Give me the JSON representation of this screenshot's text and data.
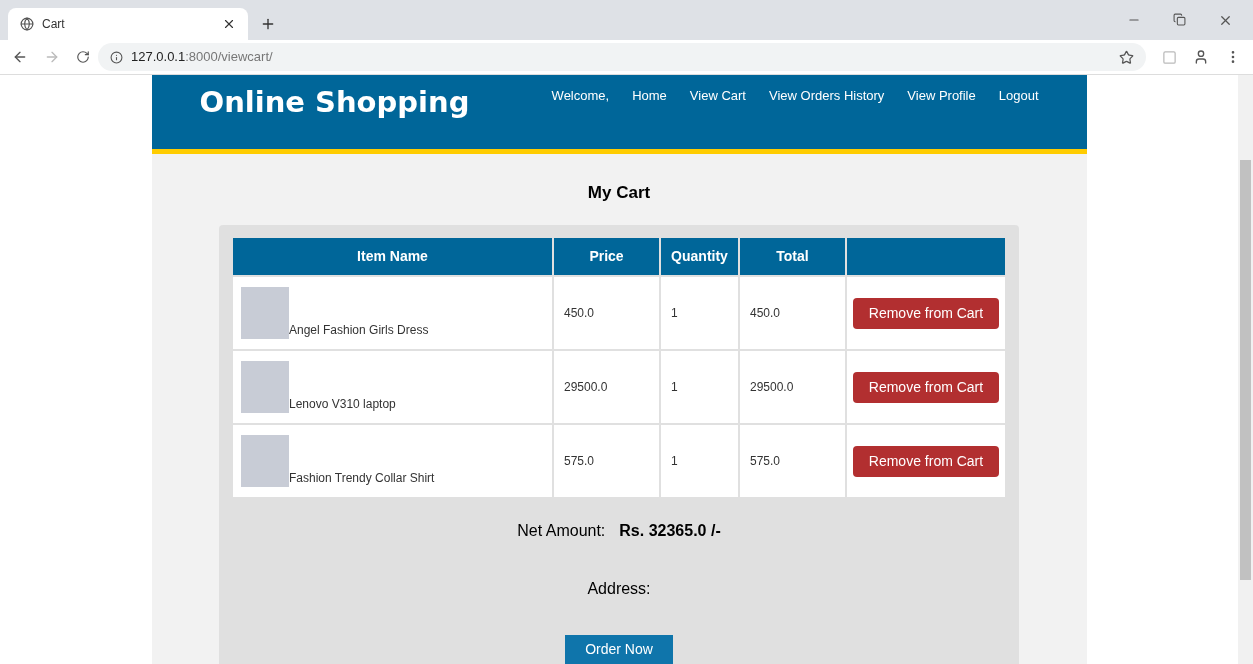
{
  "browser": {
    "tab_title": "Cart",
    "url_host": "127.0.0.1",
    "url_rest": ":8000/viewcart/"
  },
  "header": {
    "brand": "Online Shopping",
    "nav": [
      "Welcome,",
      "Home",
      "View Cart",
      "View Orders History",
      "View Profile",
      "Logout"
    ]
  },
  "page_title": "My Cart",
  "table": {
    "columns": [
      "Item Name",
      "Price",
      "Quantity",
      "Total",
      ""
    ],
    "rows": [
      {
        "name": "Angel Fashion Girls Dress",
        "price": "450.0",
        "quantity": "1",
        "total": "450.0",
        "action": "Remove from Cart"
      },
      {
        "name": "Lenovo V310 laptop",
        "price": "29500.0",
        "quantity": "1",
        "total": "29500.0",
        "action": "Remove from Cart"
      },
      {
        "name": "Fashion Trendy Collar Shirt",
        "price": "575.0",
        "quantity": "1",
        "total": "575.0",
        "action": "Remove from Cart"
      }
    ]
  },
  "net_amount": {
    "label": "Net Amount:",
    "value": "Rs. 32365.0 /-"
  },
  "address": {
    "label": "Address:"
  },
  "order_button": "Order Now"
}
